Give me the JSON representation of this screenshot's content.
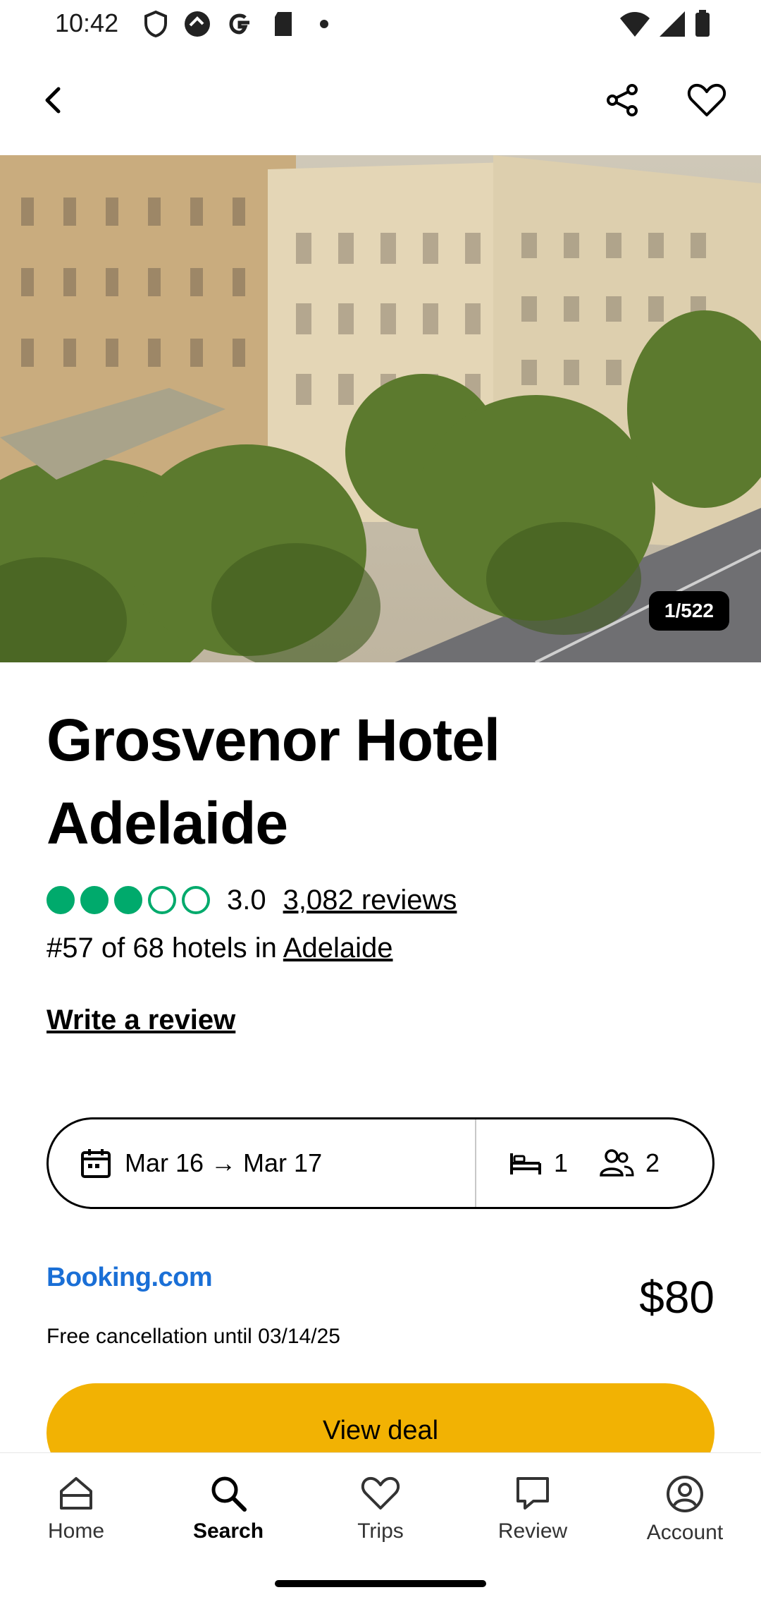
{
  "status_bar": {
    "time": "10:42"
  },
  "hero": {
    "photo_counter": "1/522"
  },
  "hotel": {
    "name": "Grosvenor Hotel Adelaide",
    "rating": "3.0",
    "rating_bubbles": 3,
    "reviews": "3,082 reviews",
    "ranking_prefix": "#57 of 68 hotels in",
    "ranking_city": "Adelaide",
    "write_review": "Write a review"
  },
  "selector": {
    "dates": "Mar 16 → Mar 17",
    "rooms": "1",
    "guests": "2"
  },
  "deal": {
    "provider": "Booking.com",
    "price": "$80",
    "cancellation": "Free cancellation until 03/14/25",
    "button": "View deal"
  },
  "bottom_nav": {
    "tabs": [
      {
        "label": "Home",
        "icon": "home-icon"
      },
      {
        "label": "Search",
        "icon": "search-icon"
      },
      {
        "label": "Trips",
        "icon": "heart-icon"
      },
      {
        "label": "Review",
        "icon": "chat-icon"
      },
      {
        "label": "Account",
        "icon": "account-icon"
      }
    ],
    "active": "Search"
  },
  "colors": {
    "accent_green": "#00aa6c",
    "cta_yellow": "#f2b203",
    "booking_blue": "#1a6fd6"
  }
}
